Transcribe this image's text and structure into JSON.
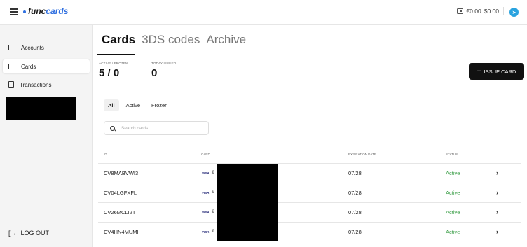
{
  "header": {
    "logo_prefix": "func",
    "logo_suffix": "cards",
    "balance_eur": "€0.00",
    "balance_usd": "$0.00"
  },
  "sidebar": {
    "items": [
      {
        "label": "Accounts"
      },
      {
        "label": "Cards"
      },
      {
        "label": "Transactions"
      }
    ],
    "logout_label": "LOG OUT"
  },
  "tabs": [
    "Cards",
    "3DS codes",
    "Archive"
  ],
  "stats": {
    "active_frozen_label": "ACTIVE / FROZEN",
    "active_frozen_value": "5 / 0",
    "today_issued_label": "TODAY ISSUED",
    "today_issued_value": "0"
  },
  "issue_button": {
    "plus": "+",
    "label": "ISSUE CARD"
  },
  "filters": [
    "All",
    "Active",
    "Frozen"
  ],
  "search": {
    "placeholder": "Search cards..."
  },
  "table": {
    "headers": [
      "ID",
      "CARD",
      "EXPIRATION DATE",
      "STATUS"
    ],
    "rows": [
      {
        "id": "CV8MABVWI3",
        "brand": "VISA",
        "currency": "€",
        "expiration": "07/28",
        "status": "Active"
      },
      {
        "id": "CV04LGFXFL",
        "brand": "VISA",
        "currency": "€",
        "expiration": "07/28",
        "status": "Active"
      },
      {
        "id": "CV26MCLI2T",
        "brand": "VISA",
        "currency": "€",
        "expiration": "07/28",
        "status": "Active"
      },
      {
        "id": "CV4HN4MUMI",
        "brand": "VISA",
        "currency": "€",
        "expiration": "07/28",
        "status": "Active"
      }
    ]
  },
  "colors": {
    "accent": "#2f6fe0",
    "status_active": "#3ea04a",
    "primary_button": "#111111",
    "telegram": "#2aa3df"
  },
  "icons": {
    "menu": "hamburger-icon",
    "wallet": "wallet-icon",
    "telegram": "telegram-icon",
    "search": "search-icon",
    "row_action": "chevron-right-icon",
    "logout": "logout-icon"
  }
}
